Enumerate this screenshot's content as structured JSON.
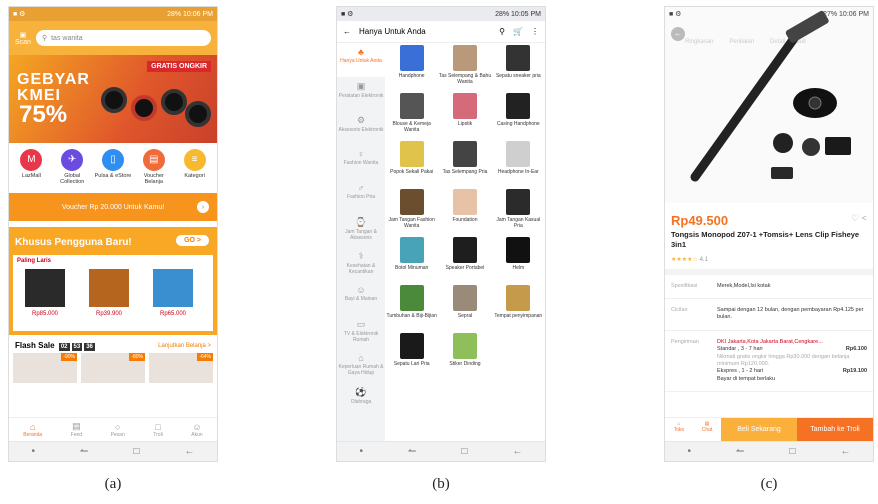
{
  "phone_a": {
    "status_time": "28% 10:06 PM",
    "scan_label": "Scan",
    "search_placeholder": "tas wanita",
    "banner": {
      "line1": "GEBYAR",
      "line2": "KMEI",
      "discount": "75%",
      "badge": "GRATIS ONGKIR"
    },
    "categories": [
      {
        "label": "LazMall",
        "color": "#e8374a",
        "icon": "M"
      },
      {
        "label": "Global Collection",
        "color": "#6c4ce0",
        "icon": "✈"
      },
      {
        "label": "Pulsa & eStore",
        "color": "#2f8ff0",
        "icon": "▯"
      },
      {
        "label": "Voucher Belanja",
        "color": "#f06a3a",
        "icon": "▤"
      },
      {
        "label": "Kategori",
        "color": "#f8b92e",
        "icon": "≡"
      }
    ],
    "voucher_text": "Voucher Rp 20.000 Untuk Kamu!",
    "new_user": {
      "title": "Khusus Pengguna Baru!",
      "go": "GO >",
      "paling": "Paling Laris",
      "products": [
        {
          "price": "Rp85.000",
          "color": "#2a2a2a"
        },
        {
          "price": "Rp39.900",
          "color": "#b5651d"
        },
        {
          "price": "Rp65.000",
          "color": "#3a8fd1"
        }
      ]
    },
    "flash_sale": {
      "title": "Flash Sale",
      "timer": [
        "02",
        "53",
        "36"
      ],
      "link": "Lanjutkan Belanja >",
      "items": [
        "-90%",
        "-80%",
        "-64%"
      ]
    },
    "tabs": [
      "Beranda",
      "Feed",
      "Pesan",
      "Troli",
      "Akun"
    ]
  },
  "phone_b": {
    "status_time": "28% 10:05 PM",
    "title": "Hanya Untuk Anda",
    "sidebar": [
      "Hanya Untuk Anda",
      "Peralatan Elektronik",
      "Aksesoris Elektronik",
      "Fashion Wanita",
      "Fashion Pria",
      "Jam Tangan & Aksesoris",
      "Kesehatan & Kecantikan",
      "Bayi & Mainan",
      "TV & Elektronik Rumah",
      "Keperluan Rumah & Gaya Hidup",
      "Olahraga"
    ],
    "grid": [
      {
        "label": "Handphone",
        "color": "#3b6fd8"
      },
      {
        "label": "Tas Selempang & Bahu Wanita",
        "color": "#b89a7a"
      },
      {
        "label": "Sepatu sneaker pria",
        "color": "#333333"
      },
      {
        "label": "Blouse & Kemeja Wanita",
        "color": "#555555"
      },
      {
        "label": "Lipstik",
        "color": "#d46a7a"
      },
      {
        "label": "Casing Handphone",
        "color": "#222222"
      },
      {
        "label": "Popok Sekali Pakai",
        "color": "#e0c34a"
      },
      {
        "label": "Tas Selempang Pria",
        "color": "#444444"
      },
      {
        "label": "Headphone In-Ear",
        "color": "#cfcfcf"
      },
      {
        "label": "Jam Tangan Fashion Wanita",
        "color": "#6b4e2e"
      },
      {
        "label": "Foundation",
        "color": "#e7c2a6"
      },
      {
        "label": "Jam Tangan Kasual Pria",
        "color": "#2b2b2b"
      },
      {
        "label": "Botol Minuman",
        "color": "#49a3b8"
      },
      {
        "label": "Speaker Portabel",
        "color": "#1e1e1e"
      },
      {
        "label": "Helm",
        "color": "#111111"
      },
      {
        "label": "Tumbuhan & Biji-Bijian",
        "color": "#4a8a3a"
      },
      {
        "label": "Sepral",
        "color": "#9a8a7a"
      },
      {
        "label": "Tempat penyimpanan",
        "color": "#c59a4a"
      },
      {
        "label": "Sepatu Lari Pria",
        "color": "#1a1a1a"
      },
      {
        "label": "Stiker Dinding",
        "color": "#8fbf5a"
      }
    ]
  },
  "phone_c": {
    "status_time": "27% 10:06 PM",
    "hero_tabs": [
      "Ringkasan",
      "Penilaian",
      "Detail Produk"
    ],
    "price": "Rp49.500",
    "title": "Tongsis Monopod Z07-1 +Tomsis+ Lens Clip Fisheye 3in1",
    "rating": "4.1",
    "rows": [
      {
        "k": "Spesifikasi",
        "v": "Merek,Model,Isi kotak"
      },
      {
        "k": "Cicilan",
        "v": "Sampai dengan 12 bulan, dengan pembayaran Rp4.125 per bulan."
      },
      {
        "k": "Pengiriman",
        "v": "DKI Jakarta,Kota Jakarta Barat,Cengkare...",
        "v2": "Standar , 3 - 7 hari",
        "v2p": "Rp6.100",
        "v3": "Nikmati gratis ongkir hingga Rp30.000 dengan belanja minimum Rp120.000.",
        "v4": "Ekspres , 1 - 2 hari",
        "v4p": "Rp19.100",
        "v5": "Bayar di tempat berlaku"
      }
    ],
    "bottom": {
      "store": "Toko",
      "chat": "Chat",
      "buy": "Beli Sekarang",
      "cart": "Tambah ke Troli"
    }
  },
  "captions": [
    "(a)",
    "(b)",
    "(c)"
  ]
}
